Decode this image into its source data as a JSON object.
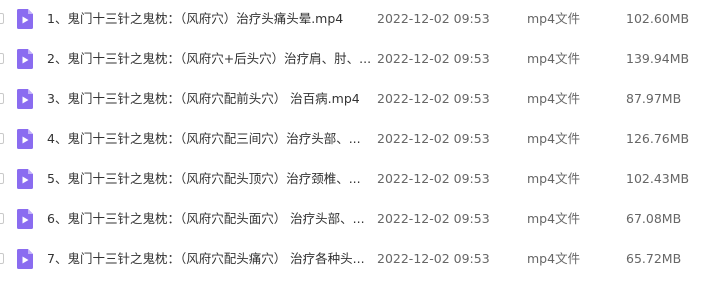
{
  "files": [
    {
      "name": "1、鬼门十三针之鬼枕：（风府穴）治疗头痛头晕.mp4",
      "date": "2022-12-02 09:53",
      "type": "mp4文件",
      "size": "102.60MB",
      "icon": "video-file-icon"
    },
    {
      "name": "2、鬼门十三针之鬼枕：（风府穴+后头穴）治疗肩、肘、...",
      "date": "2022-12-02 09:53",
      "type": "mp4文件",
      "size": "139.94MB",
      "icon": "video-file-icon"
    },
    {
      "name": "3、鬼门十三针之鬼枕：（风府穴配前头穴） 治百病.mp4",
      "date": "2022-12-02 09:53",
      "type": "mp4文件",
      "size": "87.97MB",
      "icon": "video-file-icon"
    },
    {
      "name": "4、鬼门十三针之鬼枕：（风府穴配三间穴）治疗头部、...",
      "date": "2022-12-02 09:53",
      "type": "mp4文件",
      "size": "126.76MB",
      "icon": "video-file-icon"
    },
    {
      "name": "5、鬼门十三针之鬼枕：（风府穴配头顶穴）治疗颈椎、...",
      "date": "2022-12-02 09:53",
      "type": "mp4文件",
      "size": "102.43MB",
      "icon": "video-file-icon"
    },
    {
      "name": "6、鬼门十三针之鬼枕：（风府穴配头面穴） 治疗头部、...",
      "date": "2022-12-02 09:53",
      "type": "mp4文件",
      "size": "67.08MB",
      "icon": "video-file-icon"
    },
    {
      "name": "7、鬼门十三针之鬼枕：（风府穴配头痛穴） 治疗各种头...",
      "date": "2022-12-02 09:53",
      "type": "mp4文件",
      "size": "65.72MB",
      "icon": "video-file-icon"
    }
  ],
  "colors": {
    "icon_fill": "#8a6cf0",
    "icon_fold": "#c3b3fa",
    "text_primary": "#333333",
    "text_secondary": "#666666"
  }
}
